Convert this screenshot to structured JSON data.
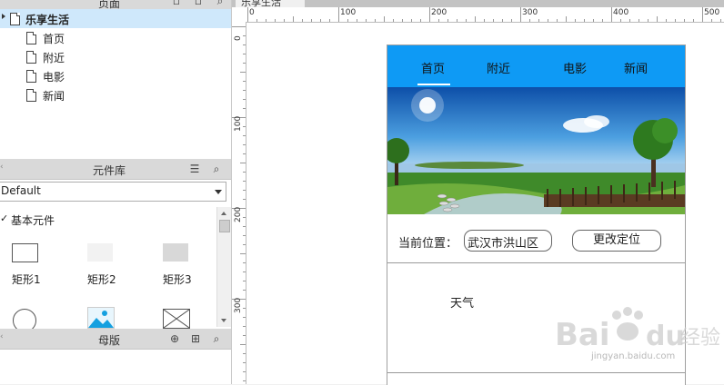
{
  "pages_panel": {
    "title": "页面",
    "root": "乐享生活",
    "children": [
      "首页",
      "附近",
      "电影",
      "新闻"
    ]
  },
  "library_panel": {
    "title": "元件库",
    "dropdown": "Default",
    "group": "基本元件",
    "widgets": [
      "矩形1",
      "矩形2",
      "矩形3"
    ]
  },
  "masters_panel": {
    "title": "母版"
  },
  "canvas_tab": {
    "label": "乐享生活"
  },
  "ruler": {
    "h_labels": [
      "0",
      "100",
      "200",
      "300",
      "400",
      "500"
    ],
    "v_labels": [
      "0",
      "100",
      "200",
      "300"
    ]
  },
  "phone": {
    "nav": [
      "首页",
      "附近",
      "电影",
      "新闻"
    ],
    "location_label": "当前位置：",
    "location_value": "武汉市洪山区",
    "change_button": "更改定位",
    "weather": "天气"
  },
  "watermark": {
    "brand": "Baidu经验",
    "url": "jingyan.baidu.com"
  },
  "colors": {
    "nav_bg": "#0e9af5",
    "selected_row": "#cfe8fb",
    "panel_header": "#d9d9d9"
  }
}
